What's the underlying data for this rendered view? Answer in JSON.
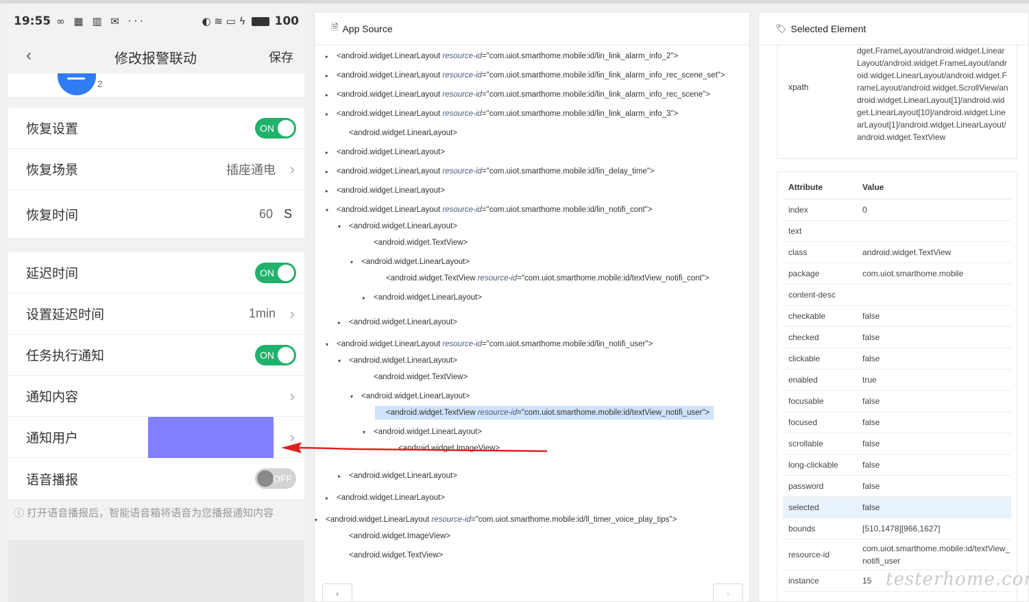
{
  "phone": {
    "status": {
      "time": "19:55",
      "left_icons": "∞ ▦ ▥ ✉ ···",
      "right_icons": "◐ ≋ ▭ ϟ",
      "battery": "100"
    },
    "nav": {
      "back": "‹",
      "title": "修改报警联动",
      "save": "保存"
    },
    "avatar_count": "2",
    "rows": {
      "restore_settings": {
        "label": "恢复设置",
        "toggle": "ON"
      },
      "restore_scene": {
        "label": "恢复场景",
        "value": "插座通电"
      },
      "restore_time": {
        "label": "恢复时间",
        "value": "60",
        "unit": "S"
      },
      "delay_time": {
        "label": "延迟时间",
        "toggle": "ON"
      },
      "set_delay": {
        "label": "设置延迟时间",
        "value": "1min"
      },
      "task_notify": {
        "label": "任务执行通知",
        "toggle": "ON"
      },
      "notify_content": {
        "label": "通知内容"
      },
      "notify_user": {
        "label": "通知用户"
      },
      "voice_broadcast": {
        "label": "语音播报",
        "toggle": "OFF"
      }
    },
    "tip": "ⓘ 打开语音播报后，智能语音箱将语音为您播报通知内容"
  },
  "source": {
    "title": "App Source",
    "nodes": [
      {
        "caret": "▸",
        "tag": "<android.widget.LinearLayout ",
        "attr": "resource-id",
        "val": "=\"com.uiot.smarthome.mobile:id/lin_link_alarm_info_2\">"
      },
      {
        "caret": "▸",
        "tag": "<android.widget.LinearLayout ",
        "attr": "resource-id",
        "val": "=\"com.uiot.smarthome.mobile:id/lin_link_alarm_info_rec_scene_set\">"
      },
      {
        "caret": "▸",
        "tag": "<android.widget.LinearLayout ",
        "attr": "resource-id",
        "val": "=\"com.uiot.smarthome.mobile:id/lin_link_alarm_info_rec_scene\">"
      },
      {
        "caret": "▸",
        "tag": "<android.widget.LinearLayout ",
        "attr": "resource-id",
        "val": "=\"com.uiot.smarthome.mobile:id/lin_link_alarm_info_3\">"
      },
      {
        "caret": "",
        "tag": "<android.widget.LinearLayout>",
        "attr": "",
        "val": ""
      },
      {
        "caret": "▸",
        "tag": "<android.widget.LinearLayout>",
        "attr": "",
        "val": ""
      },
      {
        "caret": "▸",
        "tag": "<android.widget.LinearLayout ",
        "attr": "resource-id",
        "val": "=\"com.uiot.smarthome.mobile:id/lin_delay_time\">"
      },
      {
        "caret": "▸",
        "tag": "<android.widget.LinearLayout>",
        "attr": "",
        "val": ""
      },
      {
        "caret": "▾",
        "tag": "<android.widget.LinearLayout ",
        "attr": "resource-id",
        "val": "=\"com.uiot.smarthome.mobile:id/lin_notifi_cont\">"
      },
      {
        "caret": "▾",
        "tag": "<android.widget.LinearLayout>",
        "attr": "",
        "val": ""
      },
      {
        "caret": "",
        "tag": "<android.widget.TextView>",
        "attr": "",
        "val": ""
      },
      {
        "caret": "▾",
        "tag": "<android.widget.LinearLayout>",
        "attr": "",
        "val": ""
      },
      {
        "caret": "",
        "tag": "<android.widget.TextView ",
        "attr": "resource-id",
        "val": "=\"com.uiot.smarthome.mobile:id/textView_notifi_cont\">"
      },
      {
        "caret": "▸",
        "tag": "<android.widget.LinearLayout>",
        "attr": "",
        "val": ""
      },
      {
        "caret": "▸",
        "tag": "<android.widget.LinearLayout>",
        "attr": "",
        "val": ""
      },
      {
        "caret": "▾",
        "tag": "<android.widget.LinearLayout ",
        "attr": "resource-id",
        "val": "=\"com.uiot.smarthome.mobile:id/lin_notifi_user\">"
      },
      {
        "caret": "▾",
        "tag": "<android.widget.LinearLayout>",
        "attr": "",
        "val": ""
      },
      {
        "caret": "",
        "tag": "<android.widget.TextView>",
        "attr": "",
        "val": ""
      },
      {
        "caret": "▾",
        "tag": "<android.widget.LinearLayout>",
        "attr": "",
        "val": ""
      },
      {
        "caret": "",
        "tag": "<android.widget.TextView ",
        "attr": "resource-id",
        "val": "=\"com.uiot.smarthome.mobile:id/textView_notifi_user\">"
      },
      {
        "caret": "▾",
        "tag": "<android.widget.LinearLayout>",
        "attr": "",
        "val": ""
      },
      {
        "caret": "",
        "tag": "<android.widget.ImageView>",
        "attr": "",
        "val": ""
      },
      {
        "caret": "▸",
        "tag": "<android.widget.LinearLayout>",
        "attr": "",
        "val": ""
      },
      {
        "caret": "▸",
        "tag": "<android.widget.LinearLayout>",
        "attr": "",
        "val": ""
      },
      {
        "caret": "▾",
        "tag": "<android.widget.LinearLayout ",
        "attr": "resource-id",
        "val": "=\"com.uiot.smarthome.mobile:id/ll_timer_voice_play_tips\">"
      },
      {
        "caret": "",
        "tag": "<android.widget.ImageView>",
        "attr": "",
        "val": ""
      },
      {
        "caret": "",
        "tag": "<android.widget.TextView>",
        "attr": "",
        "val": ""
      }
    ],
    "prev": "‹",
    "next": "›"
  },
  "selected": {
    "title": "Selected Element",
    "xpath_key": "xpath",
    "xpath_value": "dget.FrameLayout/android.widget.LinearLayout/android.widget.FrameLayout/android.widget.LinearLayout/android.widget.FrameLayout/android.widget.ScrollView/android.widget.LinearLayout[1]/android.widget.LinearLayout[10]/android.widget.LinearLayout[1]/android.widget.LinearLayout/android.widget.TextView",
    "columns": {
      "attribute": "Attribute",
      "value": "Value"
    },
    "attributes": [
      {
        "k": "index",
        "v": "0"
      },
      {
        "k": "text",
        "v": ""
      },
      {
        "k": "class",
        "v": "android.widget.TextView"
      },
      {
        "k": "package",
        "v": "com.uiot.smarthome.mobile"
      },
      {
        "k": "content-desc",
        "v": ""
      },
      {
        "k": "checkable",
        "v": "false"
      },
      {
        "k": "checked",
        "v": "false"
      },
      {
        "k": "clickable",
        "v": "false"
      },
      {
        "k": "enabled",
        "v": "true"
      },
      {
        "k": "focusable",
        "v": "false"
      },
      {
        "k": "focused",
        "v": "false"
      },
      {
        "k": "scrollable",
        "v": "false"
      },
      {
        "k": "long-clickable",
        "v": "false"
      },
      {
        "k": "password",
        "v": "false"
      },
      {
        "k": "selected",
        "v": "false"
      },
      {
        "k": "bounds",
        "v": "[510,1478][966,1627]"
      },
      {
        "k": "resource-id",
        "v": "com.uiot.smarthome.mobile:id/textView_notifi_user"
      },
      {
        "k": "instance",
        "v": "15"
      }
    ]
  },
  "watermark": "testerhome.com",
  "colors": {
    "toggle_on": "#1fb26a",
    "toggle_off": "#d3d3d3",
    "highlight": "#8080ff",
    "arrow": "#e02020",
    "selected_node": "#cfe3fb"
  }
}
